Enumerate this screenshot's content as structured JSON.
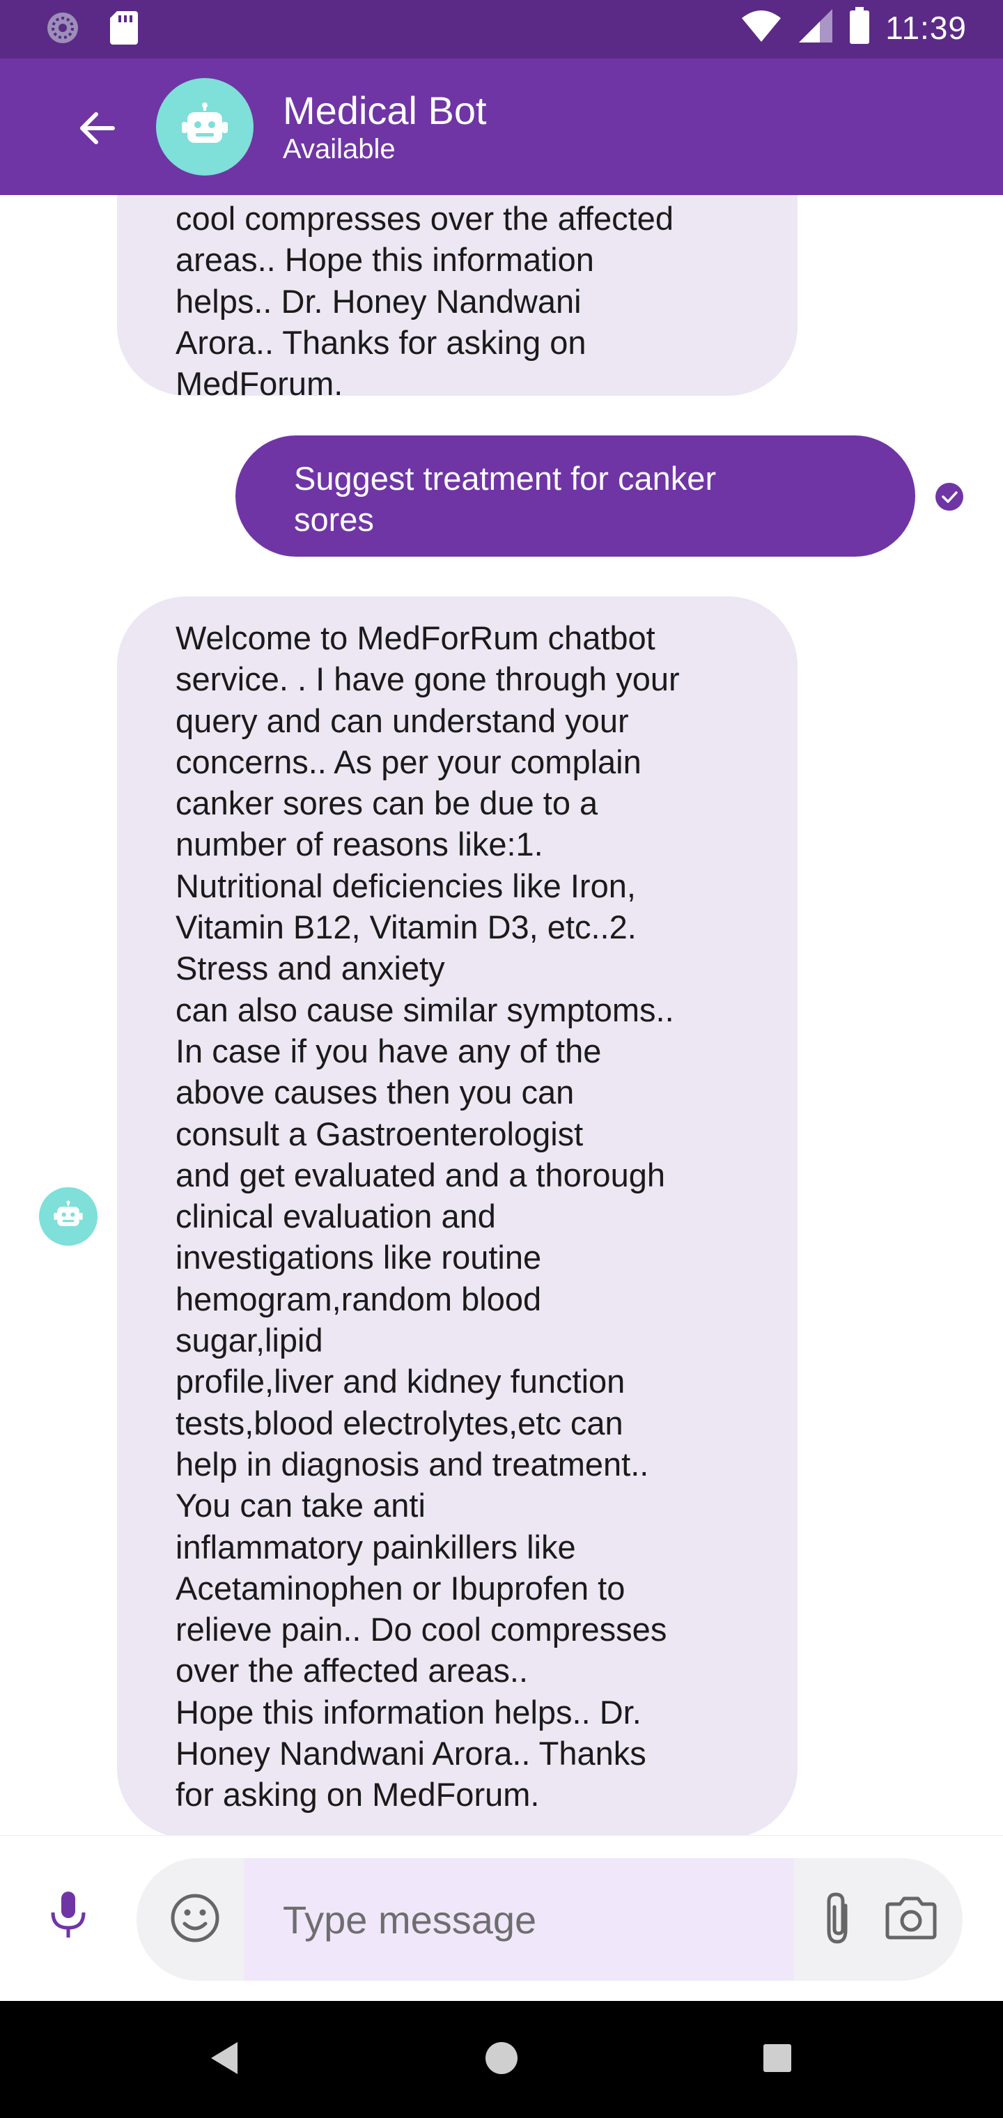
{
  "status_bar": {
    "time": "11:39",
    "icons": [
      "settings-icon",
      "sd-card-icon",
      "wifi-icon",
      "signal-icon",
      "battery-icon"
    ]
  },
  "header": {
    "bot_name": "Medical Bot",
    "bot_status": "Available",
    "icons": [
      "back-arrow-icon",
      "robot-icon"
    ]
  },
  "messages": [
    {
      "from": "bot",
      "text": "cool compresses over the affected\nareas.. Hope this information\nhelps.. Dr. Honey  Nandwani\nArora.. Thanks for asking on\nMedForum."
    },
    {
      "from": "user",
      "text": "Suggest treatment for canker\nsores",
      "status_icon": "check-circle-icon"
    },
    {
      "from": "bot",
      "text": "Welcome to MedForRum chatbot\nservice. . I have gone through your\nquery and can understand your\nconcerns.. As per your complain\ncanker sores can be due to a\nnumber of reasons like:1.\nNutritional deficiencies like  Iron,\nVitamin  B12, Vitamin  D3, etc..2.\nStress and anxiety\ncan also cause similar symptoms..\nIn case if you have any of the\nabove causes then you can\nconsult a  Gastroenterologist\nand get evaluated and a thorough\nclinical evaluation and\ninvestigations like routine\nhemogram,random blood\nsugar,lipid\nprofile,liver and kidney function\ntests,blood electrolytes,etc can\nhelp in diagnosis and treatment..\nYou can take anti\ninflammatory painkillers like\nAcetaminophen or  Ibuprofen to\nrelieve pain.. Do cool compresses\nover the affected areas..\nHope this information helps.. Dr.\nHoney  Nandwani  Arora.. Thanks\nfor asking on MedForum."
    }
  ],
  "composer": {
    "placeholder": "Type message",
    "value": "",
    "icons": [
      "microphone-icon",
      "emoji-icon",
      "attachment-icon",
      "camera-icon"
    ]
  },
  "nav_bar": {
    "icons": [
      "back-triangle-icon",
      "home-circle-icon",
      "recents-square-icon"
    ]
  },
  "colors": {
    "status_bar": "#5b2a86",
    "app_bar": "#6f35a5",
    "accent": "#6f35a5",
    "avatar": "#7fdfd9",
    "bot_bubble": "#ece7f3",
    "input_field": "#f1e7fb"
  }
}
